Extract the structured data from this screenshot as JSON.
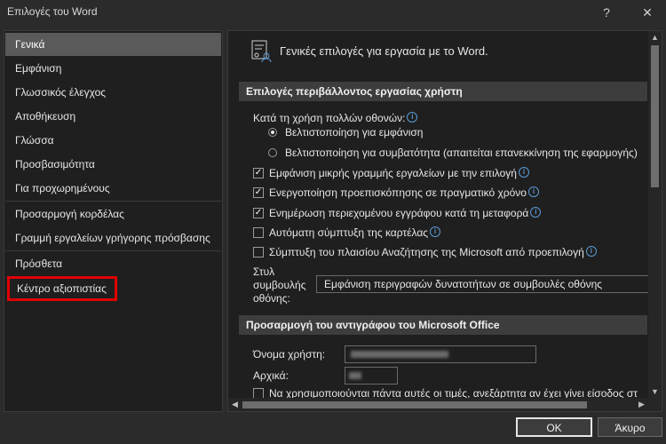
{
  "window": {
    "title": "Επιλογές του Word",
    "help_glyph": "?",
    "close_glyph": "✕"
  },
  "sidebar": {
    "items": [
      {
        "label": "Γενικά",
        "selected": true
      },
      {
        "label": "Εμφάνιση"
      },
      {
        "label": "Γλωσσικός έλεγχος"
      },
      {
        "label": "Αποθήκευση"
      },
      {
        "label": "Γλώσσα"
      },
      {
        "label": "Προσβασιμότητα"
      },
      {
        "label": "Για προχωρημένους"
      },
      {
        "label": "Προσαρμογή κορδέλας"
      },
      {
        "label": "Γραμμή εργαλείων γρήγορης πρόσβασης"
      },
      {
        "label": "Πρόσθετα"
      },
      {
        "label": "Κέντρο αξιοπιστίας",
        "highlighted": true
      }
    ]
  },
  "main": {
    "header": "Γενικές επιλογές για εργασία με το Word.",
    "section1": {
      "title": "Επιλογές περιβάλλοντος εργασίας χρήστη",
      "multi_display_label": "Κατά τη χρήση πολλών οθονών:",
      "radio_appearance": "Βελτιστοποίηση για εμφάνιση",
      "radio_compat": "Βελτιστοποίηση για συμβατότητα (απαιτείται επανεκκίνηση της εφαρμογής)",
      "chk_mini_toolbar": "Εμφάνιση μικρής γραμμής εργαλείων με την επιλογή",
      "chk_live_preview": "Ενεργοποίηση προεπισκόπησης σε πραγματικό χρόνο",
      "chk_update_content": "Ενημέρωση περιεχομένου εγγράφου κατά τη μεταφορά",
      "chk_collapse_tab": "Αυτόματη σύμπτυξη της καρτέλας",
      "chk_collapse_search": "Σύμπτυξη του πλαισίου Αναζήτησης της Microsoft από προεπιλογή",
      "screentip_label_1": "Στυλ",
      "screentip_label_2": "συμβουλής",
      "screentip_label_3": "οθόνης:",
      "screentip_value": "Εμφάνιση περιγραφών δυνατοτήτων σε συμβουλές οθόνης"
    },
    "section2": {
      "title": "Προσαρμογή του αντιγράφου του Microsoft Office",
      "username_label": "Όνομα χρήστη:",
      "initials_label": "Αρχικά:",
      "chk_always_use": "Να χρησιμοποιούνται πάντα αυτές οι τιμές, ανεξάρτητα αν έχει γίνει είσοδος στ"
    }
  },
  "footer": {
    "ok_label": "OK",
    "cancel_label": "Άκυρο"
  },
  "colors": {
    "highlight_outline": "#e00000",
    "info_icon": "#5b9bd5",
    "selected_nav": "#5a5a5a"
  }
}
